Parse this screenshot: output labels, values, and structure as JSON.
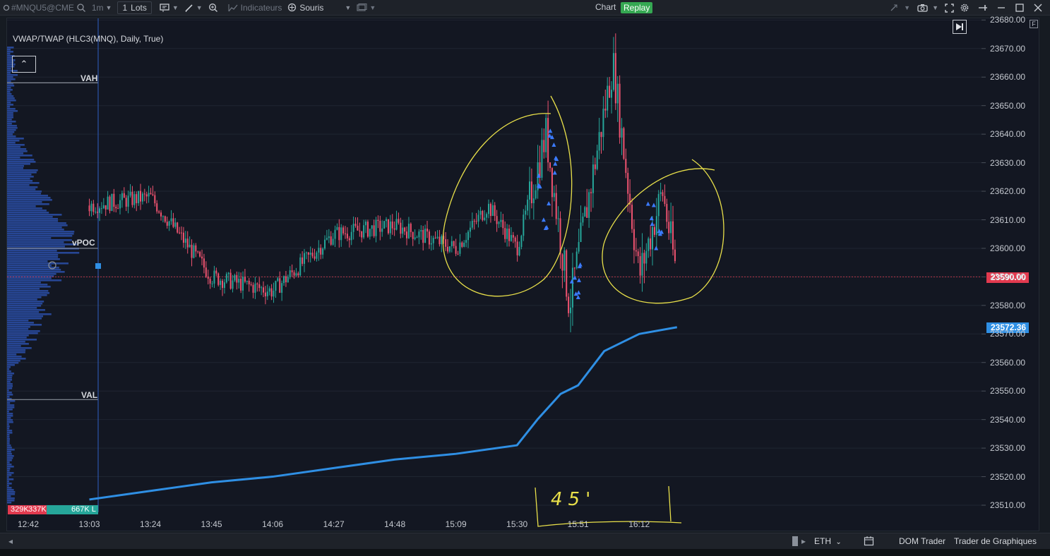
{
  "toolbar": {
    "symbol": "#MNQU5@CME",
    "timeframe": "1m",
    "lots_count": "1",
    "lots_label": "Lots",
    "indicators_label": "Indicateurs",
    "mouse_label": "Souris",
    "chart_label": "Chart",
    "replay_label": "Replay"
  },
  "chart": {
    "indicator_label": "VWAP/TWAP (HLC3(MNQ), Daily, True)",
    "profile_labels": {
      "vah": "VAH",
      "vpoc": "vPOC",
      "val": "VAL"
    },
    "volume_left": "329K",
    "volume_mid": "337K",
    "volume_right": "667K L",
    "corner_tag": "F",
    "last_price": "23590.00",
    "vwap_price": "23572.36",
    "annotation_text": "45'",
    "colors": {
      "up": "#26a69a",
      "down": "#ef5370",
      "vwap": "#2f8fe4",
      "annotation": "#e9e04a",
      "profile": "#2c4fa8"
    }
  },
  "chart_data": {
    "type": "candlestick",
    "title": "VWAP/TWAP (HLC3(MNQ), Daily, True)",
    "y_ticks": [
      23510,
      23520,
      23530,
      23540,
      23550,
      23560,
      23570,
      23580,
      23590,
      23600,
      23610,
      23620,
      23630,
      23640,
      23650,
      23660,
      23670,
      23680
    ],
    "y_tick_labels": [
      "23510.00",
      "23520.00",
      "23530.00",
      "23540.00",
      "23550.00",
      "23560.00",
      "23570.00",
      "23580.00",
      "23590.00",
      "23600.00",
      "23610.00",
      "23620.00",
      "23630.00",
      "23640.00",
      "23650.00",
      "23660.00",
      "23670.00",
      "23680.00"
    ],
    "x_tick_labels": [
      "12:42",
      "13:03",
      "13:24",
      "13:45",
      "14:06",
      "14:27",
      "14:48",
      "15:09",
      "15:30",
      "15:51",
      "16:12"
    ],
    "vwap_series": [
      {
        "t": "13:03",
        "v": 23512
      },
      {
        "t": "13:24",
        "v": 23515
      },
      {
        "t": "13:45",
        "v": 23518
      },
      {
        "t": "14:06",
        "v": 23520
      },
      {
        "t": "14:27",
        "v": 23523
      },
      {
        "t": "14:48",
        "v": 23526
      },
      {
        "t": "15:09",
        "v": 23528
      },
      {
        "t": "15:30",
        "v": 23531
      },
      {
        "t": "15:37",
        "v": 23540
      },
      {
        "t": "15:45",
        "v": 23549
      },
      {
        "t": "15:51",
        "v": 23552
      },
      {
        "t": "16:00",
        "v": 23564
      },
      {
        "t": "16:12",
        "v": 23570
      },
      {
        "t": "16:25",
        "v": 23572.36
      }
    ],
    "price_path": [
      {
        "t": "13:03",
        "v": 23615
      },
      {
        "t": "13:24",
        "v": 23618
      },
      {
        "t": "13:45",
        "v": 23590
      },
      {
        "t": "14:06",
        "v": 23585
      },
      {
        "t": "14:27",
        "v": 23605
      },
      {
        "t": "14:48",
        "v": 23608
      },
      {
        "t": "15:09",
        "v": 23600
      },
      {
        "t": "15:20",
        "v": 23615
      },
      {
        "t": "15:30",
        "v": 23600
      },
      {
        "t": "15:40",
        "v": 23640
      },
      {
        "t": "15:48",
        "v": 23580
      },
      {
        "t": "15:55",
        "v": 23620
      },
      {
        "t": "16:03",
        "v": 23665
      },
      {
        "t": "16:12",
        "v": 23590
      },
      {
        "t": "16:20",
        "v": 23620
      },
      {
        "t": "16:25",
        "v": 23590
      }
    ],
    "levels": {
      "VAH": 23658,
      "vPOC": 23600,
      "VAL": 23547
    },
    "last_price": 23590.0,
    "vwap_last": 23572.36
  },
  "bottom": {
    "session": "ETH",
    "dom_trader": "DOM Trader",
    "chart_trader": "Trader de Graphiques"
  }
}
